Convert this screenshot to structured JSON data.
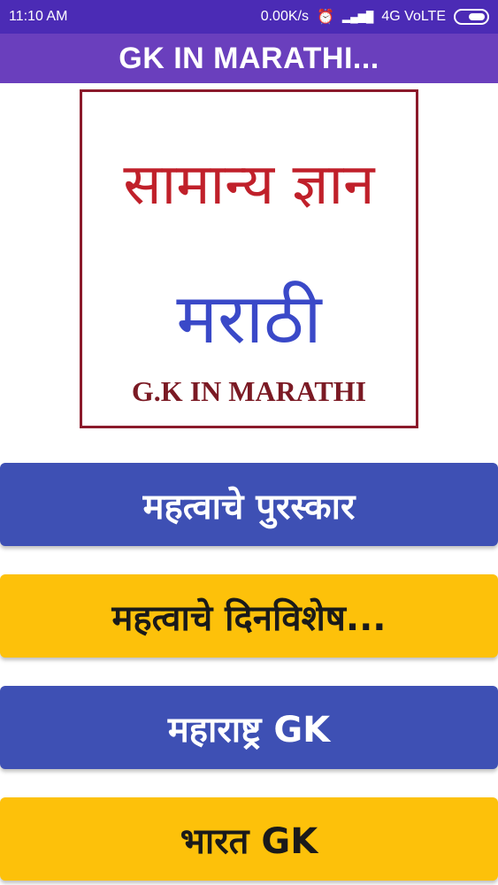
{
  "status_bar": {
    "time": "11:10 AM",
    "net_speed": "0.00K/s",
    "alarm_icon": "⏰",
    "signal_icon": "▂▄▆█",
    "network": "4G VoLTE"
  },
  "app_bar": {
    "title": "GK IN MARATHI..."
  },
  "banner": {
    "line1": "सामान्य ज्ञान",
    "line2": "मराठी",
    "line3": "G.K IN MARATHI"
  },
  "menu": [
    {
      "label": "महत्वाचे पुरस्कार",
      "color": "#3e50b4"
    },
    {
      "label": "महत्वाचे दिनविशेष...",
      "color": "#fdc10a"
    },
    {
      "label": "महाराष्ट्र GK",
      "color": "#3e50b4"
    },
    {
      "label": "भारत GK",
      "color": "#fdc10a"
    }
  ]
}
